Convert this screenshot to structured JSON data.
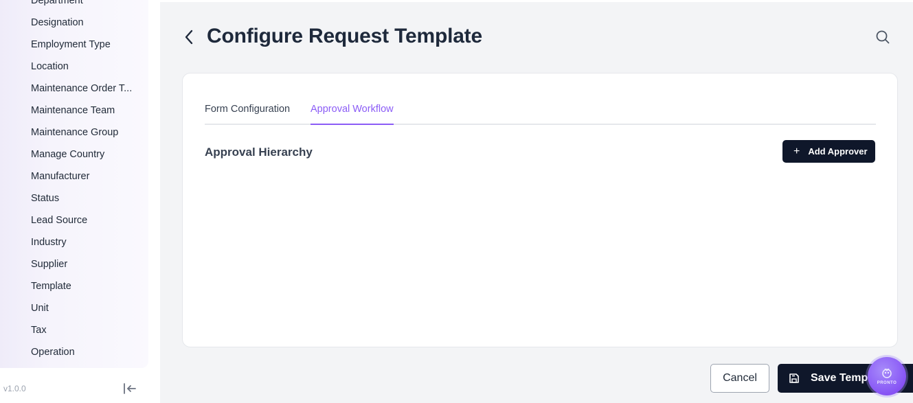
{
  "sidebar": {
    "items": [
      {
        "label": "Department"
      },
      {
        "label": "Designation"
      },
      {
        "label": "Employment Type"
      },
      {
        "label": "Location"
      },
      {
        "label": "Maintenance Order T..."
      },
      {
        "label": "Maintenance Team"
      },
      {
        "label": "Maintenance Group"
      },
      {
        "label": "Manage Country"
      },
      {
        "label": "Manufacturer"
      },
      {
        "label": "Status"
      },
      {
        "label": "Lead Source"
      },
      {
        "label": "Industry"
      },
      {
        "label": "Supplier"
      },
      {
        "label": "Template"
      },
      {
        "label": "Unit"
      },
      {
        "label": "Tax"
      },
      {
        "label": "Operation"
      }
    ],
    "version": "v1.0.0"
  },
  "header": {
    "title": "Configure Request Template"
  },
  "tabs": [
    {
      "label": "Form Configuration",
      "active": false
    },
    {
      "label": "Approval Workflow",
      "active": true
    }
  ],
  "section": {
    "title": "Approval Hierarchy",
    "add_button_label": "Add Approver"
  },
  "footer": {
    "cancel_label": "Cancel",
    "save_label": "Save Template"
  },
  "fab": {
    "label": "PRONTO"
  },
  "colors": {
    "accent": "#8b5cf6",
    "primary_button": "#0f172a",
    "background": "#f3f4f6"
  }
}
